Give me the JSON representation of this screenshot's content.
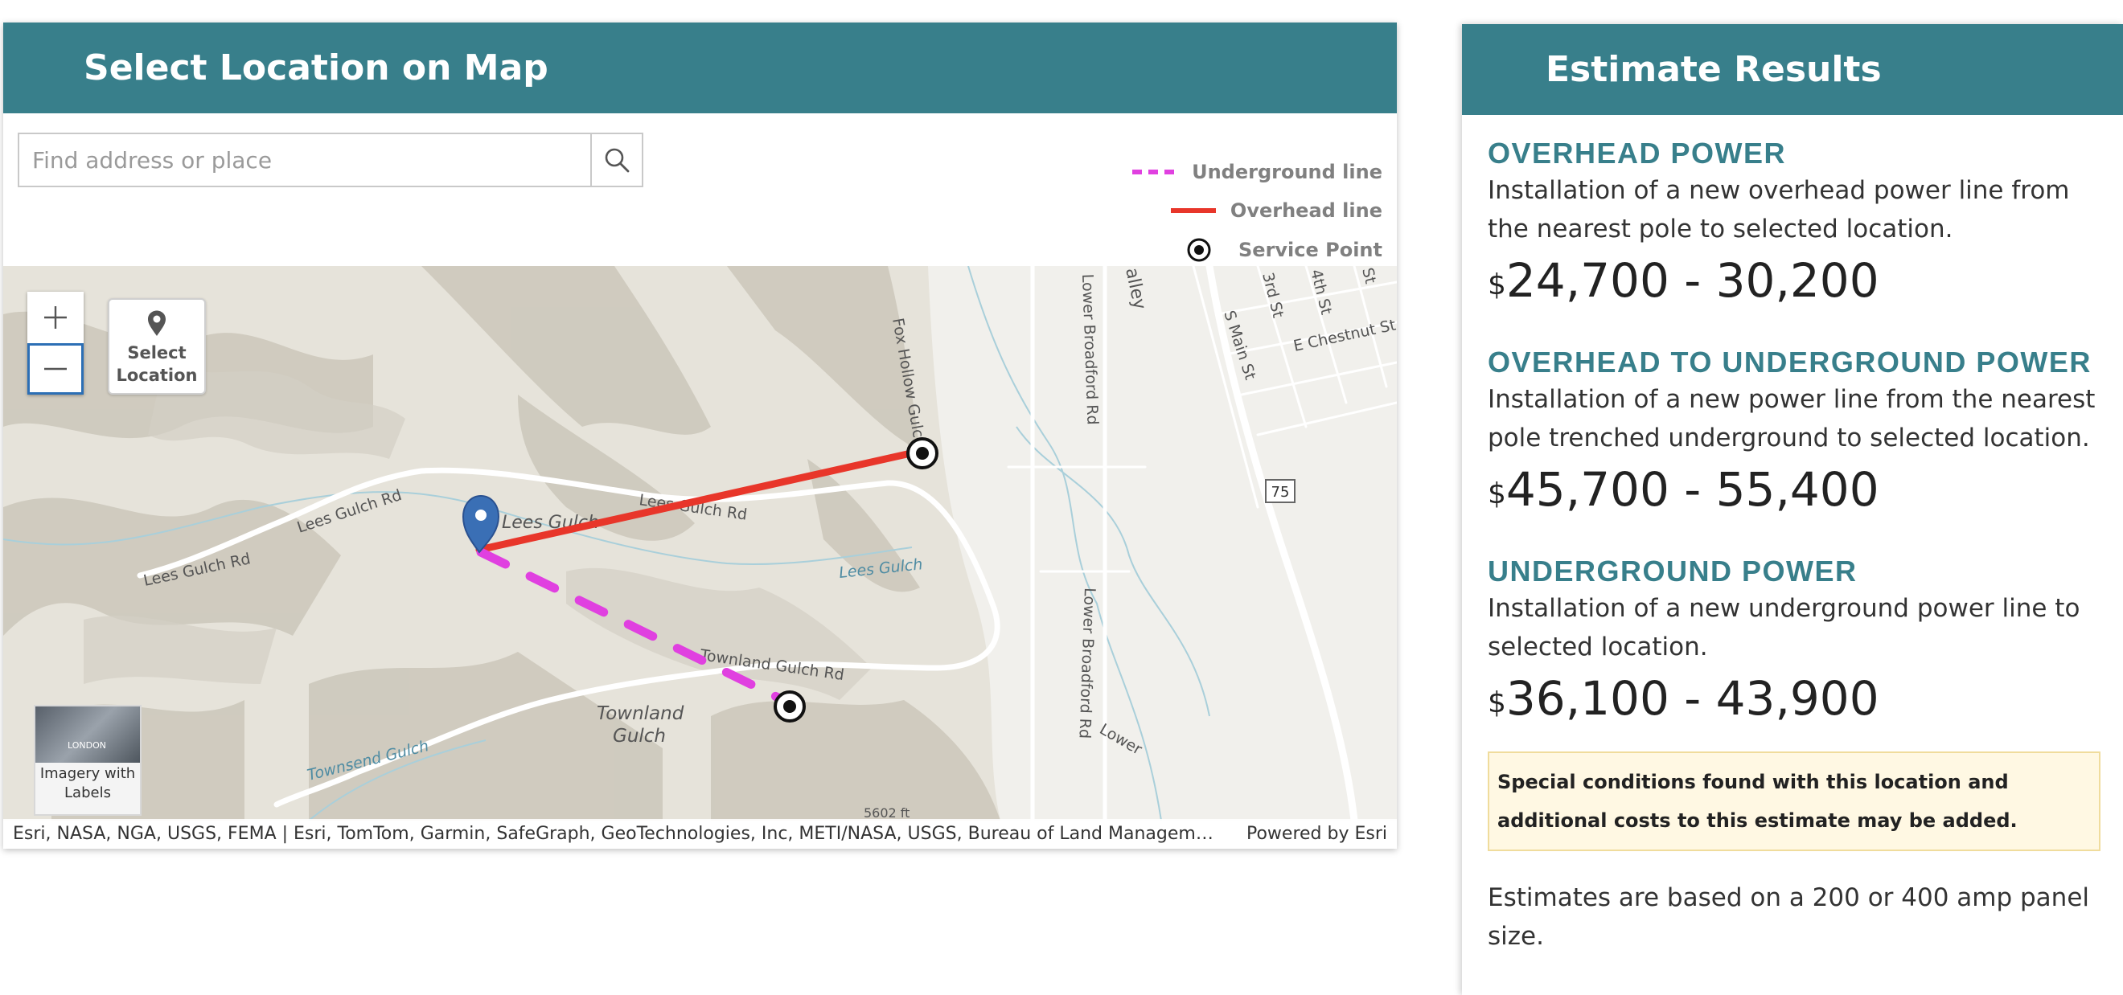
{
  "map_panel": {
    "title": "Select Location on Map",
    "search": {
      "placeholder": "Find address or place",
      "value": ""
    },
    "legend": [
      {
        "label": "Underground line",
        "color": "#e040e0"
      },
      {
        "label": "Overhead line",
        "color": "#e8362a"
      },
      {
        "label": "Service Point",
        "color": "#111111"
      }
    ],
    "select_location_label": "Select Location",
    "basemap": {
      "label": "Imagery with Labels",
      "thumb_text": "LONDON"
    },
    "attribution": "Esri, NASA, NGA, USGS, FEMA | Esri, TomTom, Garmin, SafeGraph, GeoTechnologies, Inc, METI/NASA, USGS, Bureau of Land Managem…",
    "powered_by": "Powered by Esri",
    "map_labels": {
      "lees_gulch_rd_1": "Lees Gulch Rd",
      "lees_gulch_rd_2": "Lees Gulch Rd",
      "lees_gulch_rd_3": "Lees Gulch Rd",
      "lees_gulch": "Lees Gulch",
      "lees_gulch_creek": "Lees Gulch",
      "fox_hollow": "Fox Hollow Gulch",
      "lower_broadford_1": "Lower Broadford Rd",
      "lower_broadford_2": "Lower Broadford Rd",
      "lower_label": "Lower",
      "s_main_st": "S Main St",
      "e_chestnut": "E Chestnut St",
      "third_st": "3rd St",
      "fourth_st": "4th St",
      "fifth_st": "St",
      "valley": "alley",
      "route_75": "75",
      "townland_gulch_rd": "Townland Gulch Rd",
      "townland_1": "Townland",
      "townland_2": "Gulch",
      "townsend_gulch": "Townsend Gulch",
      "elevation": "5602 ft"
    },
    "colors": {
      "header": "#387f8b",
      "overhead": "#e8362a",
      "underground": "#e040e0",
      "pin": "#3a6fb5"
    }
  },
  "results_panel": {
    "title": "Estimate Results",
    "results": [
      {
        "title": "OVERHEAD POWER",
        "description": "Installation of a new overhead power line from the nearest pole to selected location.",
        "currency": "$",
        "range": "24,700 - 30,200"
      },
      {
        "title": "OVERHEAD TO UNDERGROUND POWER",
        "description": "Installation of a new power line from the nearest pole trenched underground to selected location.",
        "currency": "$",
        "range": "45,700 - 55,400"
      },
      {
        "title": "UNDERGROUND POWER",
        "description": "Installation of a new underground power line to selected location.",
        "currency": "$",
        "range": "36,100 - 43,900"
      }
    ],
    "special_note": "Special conditions found with this location and additional costs to this estimate may be added.",
    "estimate_note": "Estimates are based on a 200 or 400 amp panel size."
  }
}
